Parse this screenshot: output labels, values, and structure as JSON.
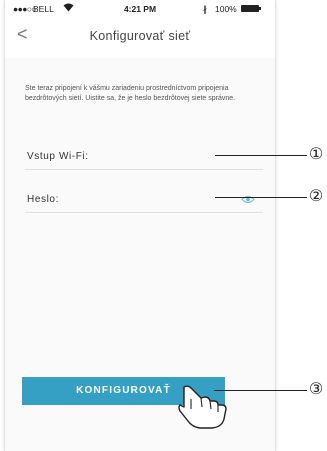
{
  "status_bar": {
    "signal": "●●●○○",
    "carrier": "BELL",
    "time": "4:21 PM",
    "bluetooth": "∦",
    "battery": "100%"
  },
  "nav": {
    "back_label": "<",
    "title": "Konfigurovať sieť"
  },
  "info_text": "Ste teraz pripojení k vášmu zariadeniu prostredníctvom pripojenia bezdrôtových sietí. Uistite sa, že je heslo bezdrôtovej siete správne.",
  "wifi_field": {
    "label": "Vstup Wi-Fi:",
    "value": ""
  },
  "password_field": {
    "label": "Heslo:",
    "value": ""
  },
  "configure_button": {
    "label": "KONFIGUROVAŤ"
  },
  "callouts": [
    "①",
    "②",
    "③"
  ],
  "colors": {
    "accent": "#35a0c4",
    "background": "#fafafa"
  },
  "icons": {
    "eye": "eye-icon",
    "hand": "hand-pointer-icon"
  }
}
